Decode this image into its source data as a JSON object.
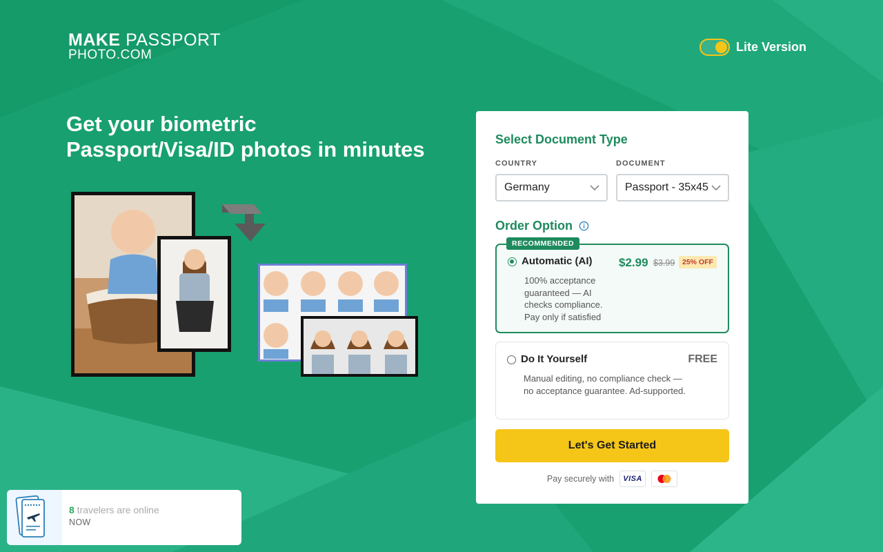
{
  "header": {
    "logo_line1_a": "MAKE",
    "logo_line1_b": "PASSPORT",
    "logo_line2": "PHOTO.COM",
    "lite_label": "Lite Version"
  },
  "hero": {
    "title_line1": "Get your biometric",
    "title_line2": "Passport/Visa/ID photos in minutes"
  },
  "form": {
    "title": "Select Document Type",
    "country_label": "COUNTRY",
    "country_value": "Germany",
    "document_label": "DOCUMENT",
    "document_value": "Passport - 35x45",
    "order_title": "Order Option",
    "options": [
      {
        "badge": "RECOMMENDED",
        "name": "Automatic (AI)",
        "desc": "100% acceptance guaranteed — AI checks compliance. Pay only if satisfied",
        "price": "$2.99",
        "old_price": "$3.99",
        "discount": "25% OFF",
        "selected": true
      },
      {
        "name": "Do It Yourself",
        "desc": "Manual editing, no compliance check — no acceptance guarantee. Ad-supported.",
        "price": "FREE",
        "selected": false
      }
    ],
    "cta_label": "Let's Get Started",
    "pay_label": "Pay securely with",
    "visa_label": "VISA"
  },
  "toast": {
    "count": "8",
    "text": " travelers are online",
    "time": "NOW"
  },
  "colors": {
    "brand_green": "#1e8a5e",
    "accent_yellow": "#f5c518",
    "background": "#1a9e6f"
  }
}
